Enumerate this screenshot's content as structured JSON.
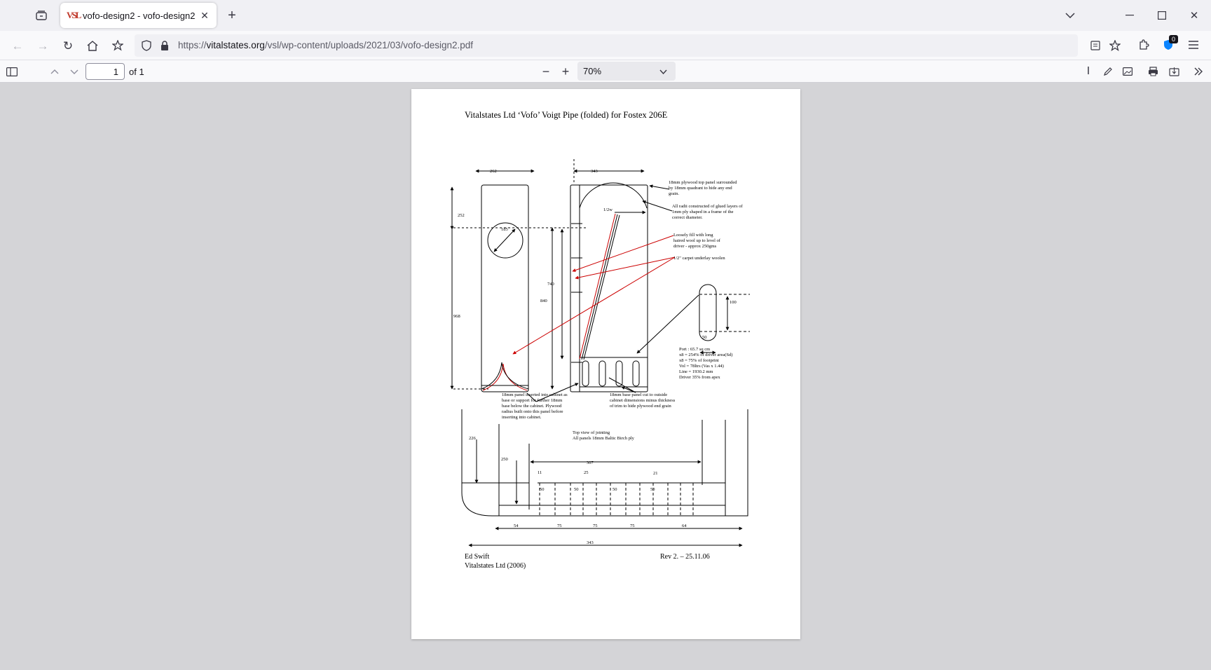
{
  "browser": {
    "tab": {
      "title": "vofo-design2 - vofo-design2.pdf",
      "favicon_text": "VSL"
    },
    "url": {
      "prefix": "https://",
      "host": "vitalstates.org",
      "path": "/vsl/wp-content/uploads/2021/03/vofo-design2.pdf"
    },
    "extension_badge": "0"
  },
  "pdf_toolbar": {
    "page_number": "1",
    "page_of": "of 1",
    "zoom": "70%"
  },
  "document": {
    "title": "Vitalstates Ltd  ‘Vofo’  Voigt Pipe (folded) for Fostex 206E",
    "dims": {
      "w262": "262",
      "w343": "343",
      "h252": "252",
      "d185": "185",
      "h968": "968",
      "h840": "840",
      "h740": "740",
      "halfw": "1/2w",
      "p100": "100",
      "p50": "50"
    },
    "notes": {
      "top_panel": [
        "18mm plywood top panel surrounded",
        "by 18mm quadrant to hide any end",
        "grain."
      ],
      "radii": [
        "All radii constructed of glued layers of",
        "1mm ply shaped in a frame of the",
        "correct diameter."
      ],
      "wool": [
        "Loosely fill with long",
        "haired wool up to level of",
        "driver - approx 250gms"
      ],
      "carpet": [
        "1/2\" carpet underlay woolen"
      ],
      "port": [
        "Port : 65.7 sq cm",
        "x8 =  254% of driver area(Sd)",
        "x8 =  75% of footprint",
        "Vol = 78ltrs (Vas x 1.44)",
        "Line = 1930.2 mm",
        "Driver 35% from apex"
      ],
      "panel_18": [
        "18mm panel inserted into cabinet as",
        "base or support for further 18mm",
        "base below the cabinet. Plywood",
        "radius built onto this panel before",
        "inserting into cabinet."
      ],
      "base_panel": [
        "18mm base panel cut to outside",
        "cabinet dimensions minus thickness",
        "of trim to hide plywood end grain"
      ],
      "top_view": [
        "Top view of jointing",
        "All panels 18mm Baltic Birch ply"
      ]
    },
    "joint_dims": {
      "d226": "226",
      "d250": "250",
      "d307": "307",
      "d11": "11",
      "d25": "25",
      "d21": "21",
      "d50": "50",
      "d54": "54",
      "d75": "75",
      "d64": "64",
      "d343": "343"
    },
    "footer": {
      "author": "Ed Swift",
      "company": "Vitalstates Ltd (2006)",
      "revision": "Rev 2. – 25.11.06"
    }
  }
}
